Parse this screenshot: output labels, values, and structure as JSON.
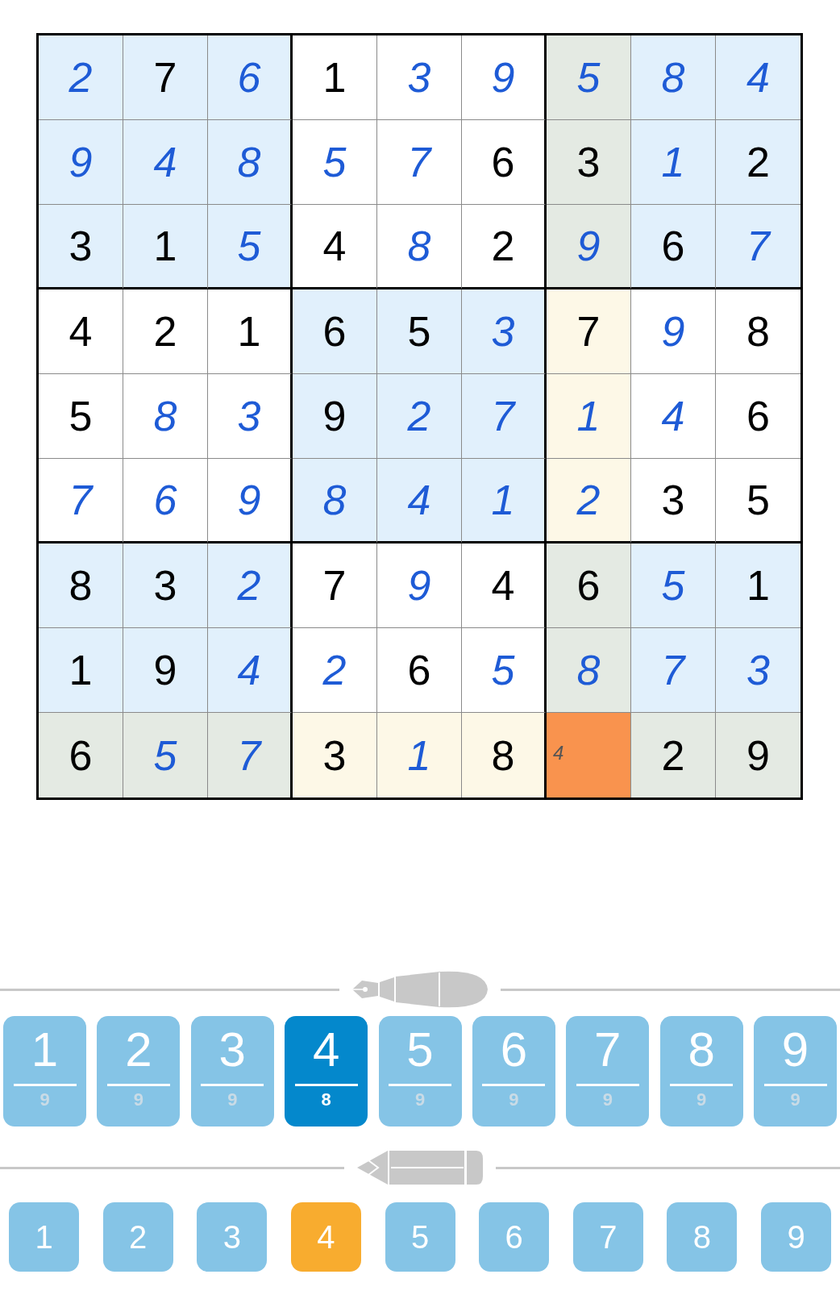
{
  "grid": [
    [
      {
        "value": "2",
        "given": false,
        "highlighted": false,
        "selected": false
      },
      {
        "value": "7",
        "given": true,
        "highlighted": false,
        "selected": false
      },
      {
        "value": "6",
        "given": false,
        "highlighted": false,
        "selected": false
      },
      {
        "value": "1",
        "given": true,
        "highlighted": false,
        "selected": false
      },
      {
        "value": "3",
        "given": false,
        "highlighted": false,
        "selected": false
      },
      {
        "value": "9",
        "given": false,
        "highlighted": false,
        "selected": false
      },
      {
        "value": "5",
        "given": false,
        "highlighted": true,
        "selected": false
      },
      {
        "value": "8",
        "given": false,
        "highlighted": false,
        "selected": false
      },
      {
        "value": "4",
        "given": false,
        "highlighted": false,
        "selected": false
      }
    ],
    [
      {
        "value": "9",
        "given": false,
        "highlighted": false,
        "selected": false
      },
      {
        "value": "4",
        "given": false,
        "highlighted": false,
        "selected": false
      },
      {
        "value": "8",
        "given": false,
        "highlighted": false,
        "selected": false
      },
      {
        "value": "5",
        "given": false,
        "highlighted": false,
        "selected": false
      },
      {
        "value": "7",
        "given": false,
        "highlighted": false,
        "selected": false
      },
      {
        "value": "6",
        "given": true,
        "highlighted": false,
        "selected": false
      },
      {
        "value": "3",
        "given": true,
        "highlighted": true,
        "selected": false
      },
      {
        "value": "1",
        "given": false,
        "highlighted": false,
        "selected": false
      },
      {
        "value": "2",
        "given": true,
        "highlighted": false,
        "selected": false
      }
    ],
    [
      {
        "value": "3",
        "given": true,
        "highlighted": false,
        "selected": false
      },
      {
        "value": "1",
        "given": true,
        "highlighted": false,
        "selected": false
      },
      {
        "value": "5",
        "given": false,
        "highlighted": false,
        "selected": false
      },
      {
        "value": "4",
        "given": true,
        "highlighted": false,
        "selected": false
      },
      {
        "value": "8",
        "given": false,
        "highlighted": false,
        "selected": false
      },
      {
        "value": "2",
        "given": true,
        "highlighted": false,
        "selected": false
      },
      {
        "value": "9",
        "given": false,
        "highlighted": true,
        "selected": false
      },
      {
        "value": "6",
        "given": true,
        "highlighted": false,
        "selected": false
      },
      {
        "value": "7",
        "given": false,
        "highlighted": false,
        "selected": false
      }
    ],
    [
      {
        "value": "4",
        "given": true,
        "highlighted": false,
        "selected": false
      },
      {
        "value": "2",
        "given": true,
        "highlighted": false,
        "selected": false
      },
      {
        "value": "1",
        "given": true,
        "highlighted": false,
        "selected": false
      },
      {
        "value": "6",
        "given": true,
        "highlighted": false,
        "selected": false
      },
      {
        "value": "5",
        "given": true,
        "highlighted": false,
        "selected": false
      },
      {
        "value": "3",
        "given": false,
        "highlighted": false,
        "selected": false
      },
      {
        "value": "7",
        "given": true,
        "highlighted": true,
        "selected": false
      },
      {
        "value": "9",
        "given": false,
        "highlighted": false,
        "selected": false
      },
      {
        "value": "8",
        "given": true,
        "highlighted": false,
        "selected": false
      }
    ],
    [
      {
        "value": "5",
        "given": true,
        "highlighted": false,
        "selected": false
      },
      {
        "value": "8",
        "given": false,
        "highlighted": false,
        "selected": false
      },
      {
        "value": "3",
        "given": false,
        "highlighted": false,
        "selected": false
      },
      {
        "value": "9",
        "given": true,
        "highlighted": false,
        "selected": false
      },
      {
        "value": "2",
        "given": false,
        "highlighted": false,
        "selected": false
      },
      {
        "value": "7",
        "given": false,
        "highlighted": false,
        "selected": false
      },
      {
        "value": "1",
        "given": false,
        "highlighted": true,
        "selected": false
      },
      {
        "value": "4",
        "given": false,
        "highlighted": false,
        "selected": false
      },
      {
        "value": "6",
        "given": true,
        "highlighted": false,
        "selected": false
      }
    ],
    [
      {
        "value": "7",
        "given": false,
        "highlighted": false,
        "selected": false
      },
      {
        "value": "6",
        "given": false,
        "highlighted": false,
        "selected": false
      },
      {
        "value": "9",
        "given": false,
        "highlighted": false,
        "selected": false
      },
      {
        "value": "8",
        "given": false,
        "highlighted": false,
        "selected": false
      },
      {
        "value": "4",
        "given": false,
        "highlighted": false,
        "selected": false
      },
      {
        "value": "1",
        "given": false,
        "highlighted": false,
        "selected": false
      },
      {
        "value": "2",
        "given": false,
        "highlighted": true,
        "selected": false
      },
      {
        "value": "3",
        "given": true,
        "highlighted": false,
        "selected": false
      },
      {
        "value": "5",
        "given": true,
        "highlighted": false,
        "selected": false
      }
    ],
    [
      {
        "value": "8",
        "given": true,
        "highlighted": false,
        "selected": false
      },
      {
        "value": "3",
        "given": true,
        "highlighted": false,
        "selected": false
      },
      {
        "value": "2",
        "given": false,
        "highlighted": false,
        "selected": false
      },
      {
        "value": "7",
        "given": true,
        "highlighted": false,
        "selected": false
      },
      {
        "value": "9",
        "given": false,
        "highlighted": false,
        "selected": false
      },
      {
        "value": "4",
        "given": true,
        "highlighted": false,
        "selected": false
      },
      {
        "value": "6",
        "given": true,
        "highlighted": true,
        "selected": false
      },
      {
        "value": "5",
        "given": false,
        "highlighted": false,
        "selected": false
      },
      {
        "value": "1",
        "given": true,
        "highlighted": false,
        "selected": false
      }
    ],
    [
      {
        "value": "1",
        "given": true,
        "highlighted": false,
        "selected": false
      },
      {
        "value": "9",
        "given": true,
        "highlighted": false,
        "selected": false
      },
      {
        "value": "4",
        "given": false,
        "highlighted": false,
        "selected": false
      },
      {
        "value": "2",
        "given": false,
        "highlighted": false,
        "selected": false
      },
      {
        "value": "6",
        "given": true,
        "highlighted": false,
        "selected": false
      },
      {
        "value": "5",
        "given": false,
        "highlighted": false,
        "selected": false
      },
      {
        "value": "8",
        "given": false,
        "highlighted": true,
        "selected": false
      },
      {
        "value": "7",
        "given": false,
        "highlighted": false,
        "selected": false
      },
      {
        "value": "3",
        "given": false,
        "highlighted": false,
        "selected": false
      }
    ],
    [
      {
        "value": "6",
        "given": true,
        "highlighted": true,
        "selected": false
      },
      {
        "value": "5",
        "given": false,
        "highlighted": true,
        "selected": false
      },
      {
        "value": "7",
        "given": false,
        "highlighted": true,
        "selected": false
      },
      {
        "value": "3",
        "given": true,
        "highlighted": true,
        "selected": false
      },
      {
        "value": "1",
        "given": false,
        "highlighted": true,
        "selected": false
      },
      {
        "value": "8",
        "given": true,
        "highlighted": true,
        "selected": false
      },
      {
        "notes": [
          "4"
        ],
        "selected": true
      },
      {
        "value": "2",
        "given": true,
        "highlighted": true,
        "selected": false
      },
      {
        "value": "9",
        "given": true,
        "highlighted": true,
        "selected": false
      }
    ]
  ],
  "pen_buttons": [
    {
      "digit": "1",
      "count": "9",
      "selected": false
    },
    {
      "digit": "2",
      "count": "9",
      "selected": false
    },
    {
      "digit": "3",
      "count": "9",
      "selected": false
    },
    {
      "digit": "4",
      "count": "8",
      "selected": true
    },
    {
      "digit": "5",
      "count": "9",
      "selected": false
    },
    {
      "digit": "6",
      "count": "9",
      "selected": false
    },
    {
      "digit": "7",
      "count": "9",
      "selected": false
    },
    {
      "digit": "8",
      "count": "9",
      "selected": false
    },
    {
      "digit": "9",
      "count": "9",
      "selected": false
    }
  ],
  "pencil_buttons": [
    {
      "digit": "1",
      "selected": false
    },
    {
      "digit": "2",
      "selected": false
    },
    {
      "digit": "3",
      "selected": false
    },
    {
      "digit": "4",
      "selected": true
    },
    {
      "digit": "5",
      "selected": false
    },
    {
      "digit": "6",
      "selected": false
    },
    {
      "digit": "7",
      "selected": false
    },
    {
      "digit": "8",
      "selected": false
    },
    {
      "digit": "9",
      "selected": false
    }
  ]
}
